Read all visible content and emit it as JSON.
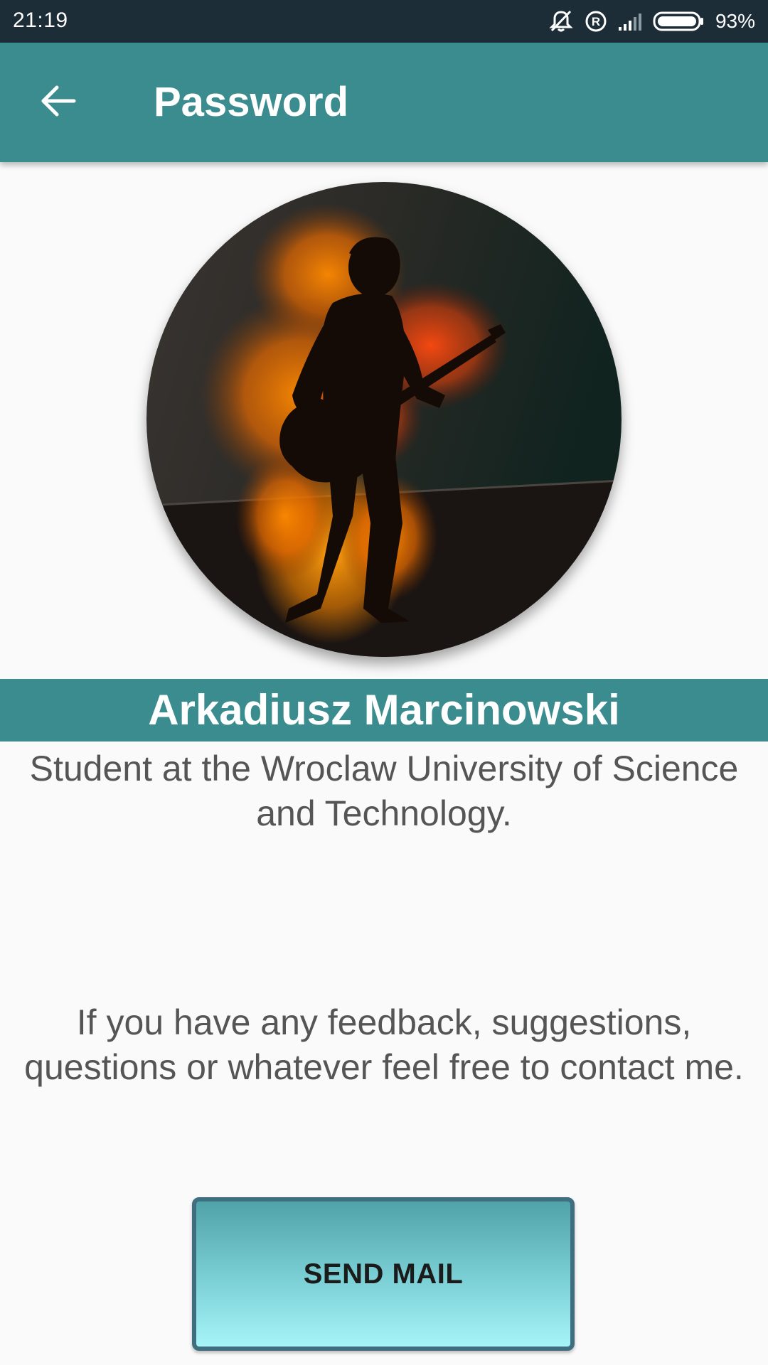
{
  "status_bar": {
    "time": "21:19",
    "battery_percent": "93%",
    "icons": [
      "vibrate-off-icon",
      "registered-icon",
      "signal-icon",
      "battery-icon"
    ]
  },
  "toolbar": {
    "back_icon": "arrow-left-icon",
    "title": "Password"
  },
  "profile": {
    "avatar": "guitarist-silhouette-image",
    "name": "Arkadiusz Marcinowski",
    "description": "Student at the Wroclaw University of Science and Technology."
  },
  "feedback": {
    "text": "If you have any feedback, suggestions, questions or whatever feel free to contact me."
  },
  "actions": {
    "send_mail_label": "SEND MAIL"
  },
  "colors": {
    "status_bar": "#1d2d38",
    "primary": "#3b8c8e",
    "background": "#fafafa",
    "text": "#555555",
    "button_top": "#50a3a9",
    "button_bottom": "#a6f4f8",
    "button_border": "#3f6e80"
  }
}
